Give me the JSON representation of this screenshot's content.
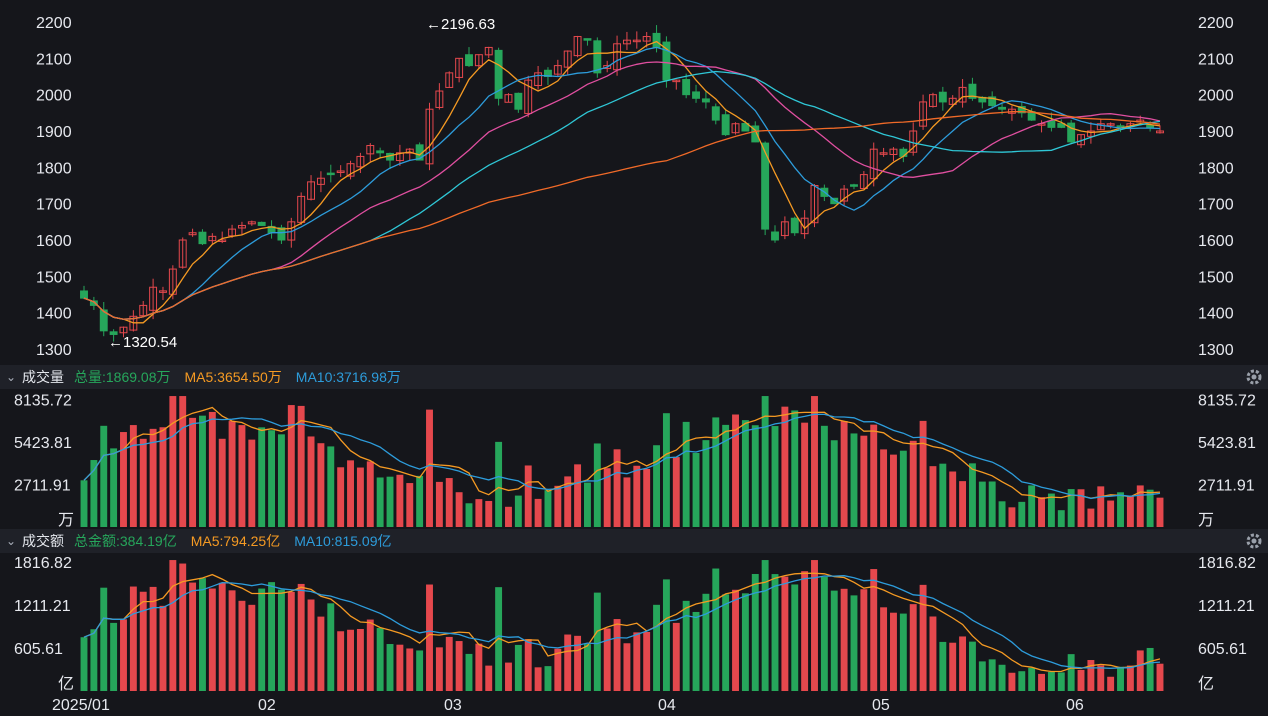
{
  "colors": {
    "up": "#e5484d",
    "down": "#26a65b",
    "ma5": "#f59a23",
    "ma10": "#2d9cdb",
    "ma20": "#e04fa0",
    "ma30": "#2fc7d6",
    "ma60": "#f06a28"
  },
  "price_panel": {
    "y_ticks": [
      "2200",
      "2100",
      "2000",
      "1900",
      "1800",
      "1700",
      "1600",
      "1500",
      "1400",
      "1300"
    ],
    "high_label": "←2196.63",
    "low_label": "←1320.54"
  },
  "volume_panel": {
    "title": "成交量",
    "total": "总量:1869.08万",
    "ma5": "MA5:3654.50万",
    "ma10": "MA10:3716.98万",
    "y_ticks": [
      "8135.72",
      "5423.81",
      "2711.91"
    ],
    "unit": "万"
  },
  "amount_panel": {
    "title": "成交额",
    "total": "总金额:384.19亿",
    "ma5": "MA5:794.25亿",
    "ma10": "MA10:815.09亿",
    "y_ticks": [
      "1816.82",
      "1211.21",
      "605.61"
    ],
    "unit": "亿"
  },
  "x_ticks": [
    "2025/01",
    "02",
    "03",
    "04",
    "05",
    "06"
  ],
  "chart_data": {
    "type": "candlestick",
    "price": {
      "ylim": [
        1280,
        2240
      ],
      "high": 2196.63,
      "low": 1320.54,
      "close_approx": [
        1440,
        1420,
        1350,
        1340,
        1360,
        1390,
        1420,
        1470,
        1460,
        1520,
        1600,
        1620,
        1590,
        1610,
        1600,
        1630,
        1640,
        1650,
        1640,
        1620,
        1600,
        1650,
        1720,
        1760,
        1770,
        1780,
        1790,
        1810,
        1830,
        1860,
        1840,
        1820,
        1840,
        1850,
        1820,
        1960,
        2010,
        2060,
        2100,
        2080,
        2110,
        2130,
        1990,
        2000,
        1960,
        2040,
        2060,
        2050,
        2080,
        2120,
        2160,
        2150,
        2060,
        2080,
        2140,
        2150,
        2150,
        2160,
        2130,
        2040,
        2040,
        2000,
        1990,
        1980,
        1930,
        1890,
        1920,
        1900,
        1870,
        1630,
        1600,
        1650,
        1620,
        1660,
        1750,
        1720,
        1700,
        1740,
        1750,
        1780,
        1850,
        1840,
        1850,
        1830,
        1900,
        1980,
        2000,
        1980,
        1990,
        2020,
        1990,
        1980,
        1970,
        1960,
        1960,
        1950,
        1930,
        1920,
        1910,
        1910,
        1870,
        1890,
        1900,
        1920,
        1920,
        1910,
        1920,
        1930,
        1910,
        1900
      ]
    },
    "volume": {
      "ylim": [
        0,
        8600
      ],
      "unit": "万",
      "last": 1869.08,
      "ma5_last": 3654.5,
      "ma10_last": 3716.98
    },
    "amount": {
      "ylim": [
        0,
        1900
      ],
      "unit": "亿",
      "last": 384.19,
      "ma5_last": 794.25,
      "ma10_last": 815.09
    }
  }
}
